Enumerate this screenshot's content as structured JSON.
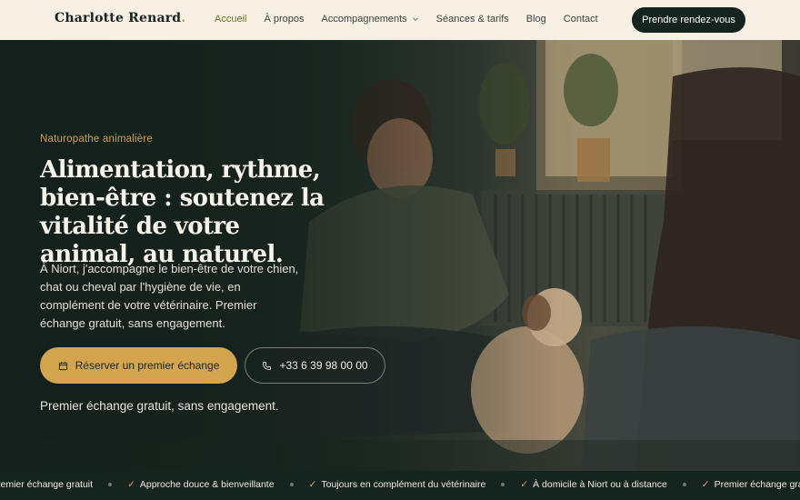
{
  "header": {
    "logo_text": "Charlotte Renard",
    "logo_dot": ".",
    "nav": [
      {
        "label": "Accueil",
        "active": true
      },
      {
        "label": "À propos"
      },
      {
        "label": "Accompagnements",
        "has_dropdown": true
      },
      {
        "label": "Séances & tarifs"
      },
      {
        "label": "Blog"
      },
      {
        "label": "Contact"
      }
    ],
    "cta_label": "Prendre rendez-vous"
  },
  "hero": {
    "eyebrow": "Naturopathe animalière",
    "title": "Alimentation, rythme, bien-être : soutenez la vitalité de votre animal, au naturel.",
    "lead": "À Niort, j'accompagne le bien-être de votre chien, chat ou cheval par l'hygiène de vie, en complément de votre vétérinaire. Premier échange gratuit, sans engagement.",
    "primary_button": {
      "label": "Réserver un premier échange",
      "icon": "calendar-icon"
    },
    "secondary_button": {
      "label": "+33 6 39 98 00 00",
      "icon": "phone-icon"
    },
    "note": "Premier échange gratuit, sans engagement."
  },
  "band": {
    "first_partial": "remier échange gratuit",
    "items": [
      "Approche douce & bienveillante",
      "Toujours en complément du vétérinaire",
      "À domicile à Niort ou à distance",
      "Premier échange gratu"
    ]
  },
  "colors": {
    "accent": "#d4a54f",
    "dark": "#16241f",
    "header_bg": "#f5efe4",
    "nav_active": "#6b7a1f"
  }
}
